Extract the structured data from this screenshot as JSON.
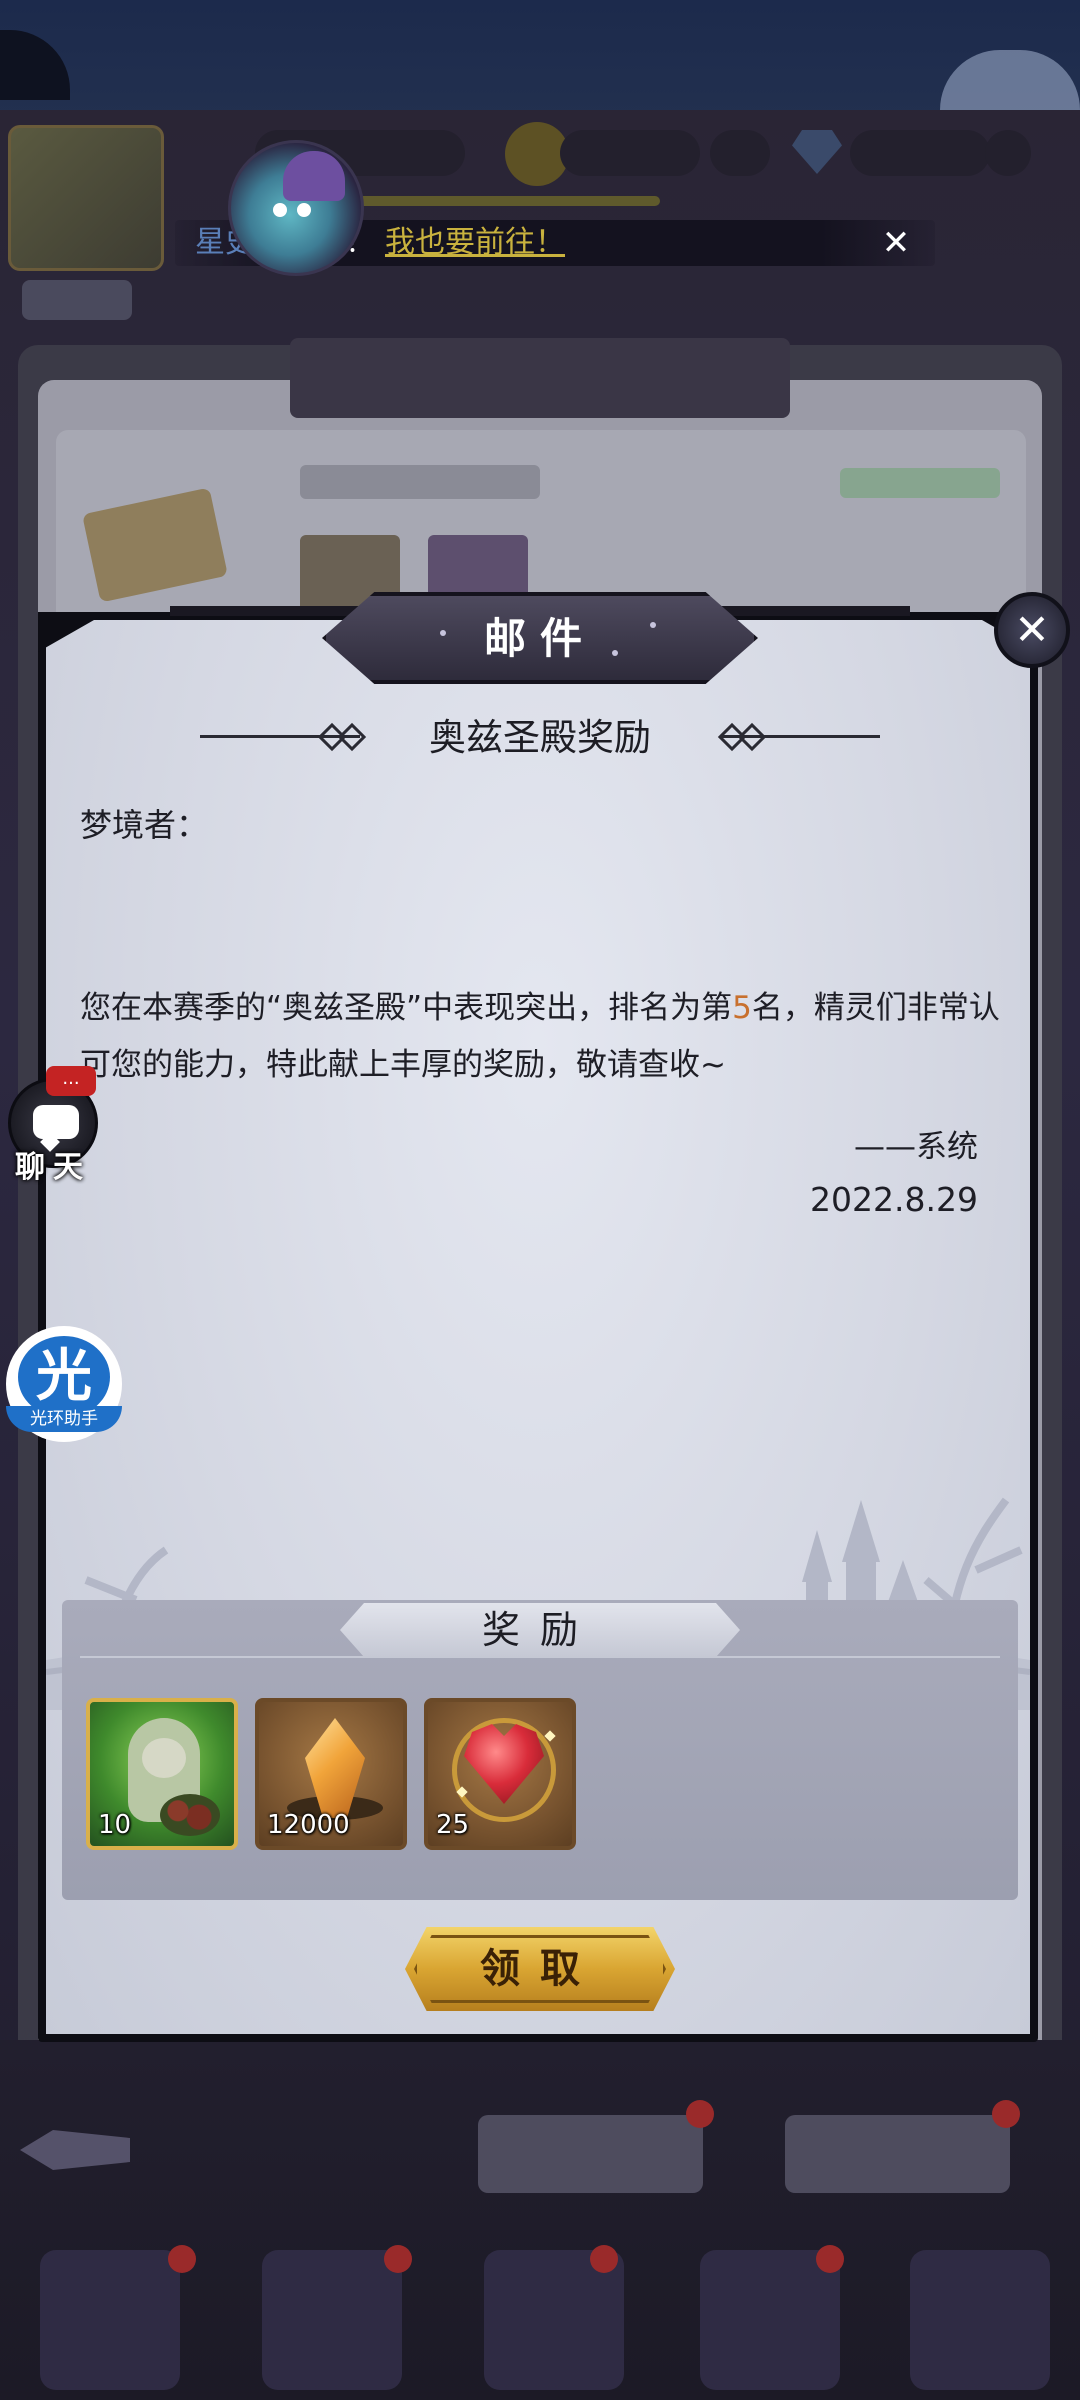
{
  "ticker": {
    "text": "星史",
    "text_tail": "！",
    "link": "我也要前往！",
    "close_icon": "close-icon"
  },
  "mail_dialog": {
    "header_title": "邮件",
    "subject": "奥兹圣殿奖励",
    "greeting": "梦境者：",
    "body_before_rank": "您在本赛季的“奥兹圣殿”中表现突出，排名为第",
    "rank": "5",
    "body_after_rank": "名，精灵们非常认可您的能力，特此献上丰厚的奖励，敬请查收~",
    "signature": "——系统",
    "date": "2022.8.29",
    "rewards_title": "奖励",
    "rewards": [
      {
        "icon": "hero-card-icon",
        "count": "10"
      },
      {
        "icon": "crystal-icon",
        "count": "12000"
      },
      {
        "icon": "heart-gem-icon",
        "count": "25"
      }
    ],
    "claim_label": "领取",
    "close_icon": "close-icon"
  },
  "side_buttons": {
    "chat_label": "聊天",
    "chat_badge": "...",
    "assistant_glyph": "光",
    "assistant_label": "光环助手"
  },
  "colors": {
    "rank_highlight": "#c8702e",
    "claim_button": "#d9a532",
    "ticker_link": "#c9b23e"
  }
}
